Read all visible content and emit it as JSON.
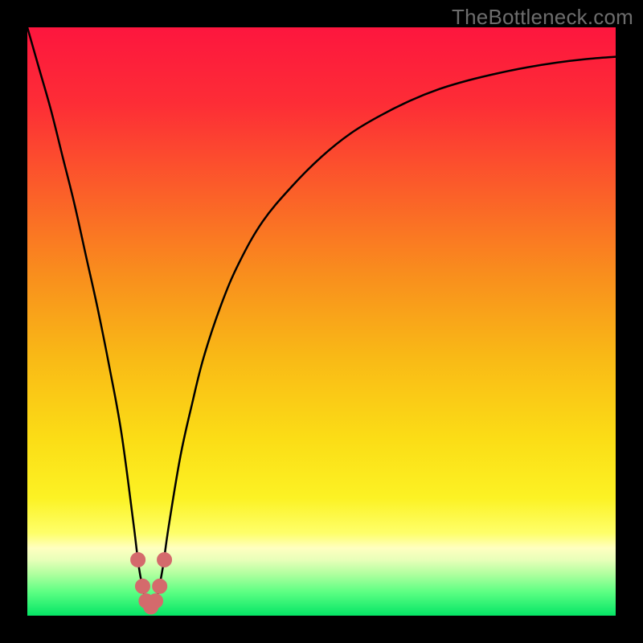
{
  "watermark": {
    "text": "TheBottleneck.com"
  },
  "chart_data": {
    "type": "line",
    "title": "",
    "xlabel": "",
    "ylabel": "",
    "xlim": [
      0,
      100
    ],
    "ylim": [
      0,
      100
    ],
    "grid": false,
    "legend": false,
    "background_gradient": {
      "direction": "vertical",
      "stops": [
        {
          "pos": 0.0,
          "color": "#fd163e"
        },
        {
          "pos": 0.13,
          "color": "#fd2d36"
        },
        {
          "pos": 0.28,
          "color": "#fb5f29"
        },
        {
          "pos": 0.42,
          "color": "#f98e1d"
        },
        {
          "pos": 0.56,
          "color": "#f9b916"
        },
        {
          "pos": 0.7,
          "color": "#fbdd16"
        },
        {
          "pos": 0.8,
          "color": "#fcf224"
        },
        {
          "pos": 0.86,
          "color": "#feff6a"
        },
        {
          "pos": 0.885,
          "color": "#ffffc0"
        },
        {
          "pos": 0.905,
          "color": "#e8ffb9"
        },
        {
          "pos": 0.93,
          "color": "#aeff9e"
        },
        {
          "pos": 0.96,
          "color": "#5cff83"
        },
        {
          "pos": 1.0,
          "color": "#05e566"
        }
      ]
    },
    "series": [
      {
        "name": "bottleneck-curve",
        "stroke": "#000000",
        "stroke_width": 2.5,
        "x": [
          0,
          2,
          4,
          6,
          8,
          10,
          12,
          14,
          16,
          18,
          19,
          20,
          20.5,
          21,
          21.5,
          22,
          23,
          24,
          26,
          28,
          30,
          33,
          36,
          40,
          45,
          50,
          55,
          60,
          65,
          70,
          75,
          80,
          85,
          90,
          95,
          100
        ],
        "y": [
          100,
          93,
          86,
          78,
          70,
          61,
          52,
          42,
          31,
          16,
          8,
          3,
          1.5,
          1,
          1.5,
          3,
          8,
          15,
          27,
          36,
          44,
          53,
          60,
          67,
          73,
          78,
          82,
          85,
          87.5,
          89.5,
          91,
          92.2,
          93.2,
          94,
          94.6,
          95
        ]
      }
    ],
    "markers": {
      "name": "trough-markers",
      "fill": "#d46a6c",
      "stroke": "#d46a6c",
      "radius": 9,
      "points": [
        {
          "x": 18.8,
          "y": 9.5
        },
        {
          "x": 19.6,
          "y": 5.0
        },
        {
          "x": 20.2,
          "y": 2.5
        },
        {
          "x": 21.0,
          "y": 1.5
        },
        {
          "x": 21.8,
          "y": 2.5
        },
        {
          "x": 22.5,
          "y": 5.0
        },
        {
          "x": 23.3,
          "y": 9.5
        }
      ]
    }
  }
}
